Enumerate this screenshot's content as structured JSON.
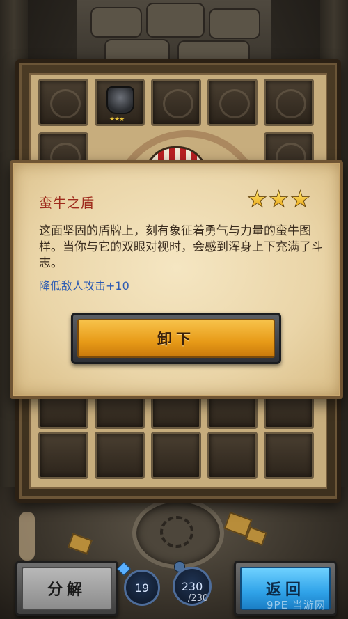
{
  "item": {
    "name": "蛮牛之盾",
    "star_count": 3,
    "description": "这面坚固的盾牌上，刻有象征着勇气与力量的蛮牛图样。当你与它的双眼对视时，会感到浑身上下充满了斗志。",
    "effect": "降低敌人攻击+10"
  },
  "buttons": {
    "unequip_label": "卸下",
    "decompose_label": "分解",
    "back_label": "返回"
  },
  "counters": {
    "gem_value": "19",
    "inventory_count": "230",
    "inventory_max": "/230"
  },
  "watermark": "9PE 当游网",
  "colors": {
    "item_name": "#9e2b1c",
    "effect_text": "#2c5bb3",
    "unequip_button": "#e79a17",
    "back_button": "#2fa2e8",
    "decompose_button": "#8c8c8c"
  },
  "inventory": {
    "equipped_slot_icon": "armor-icon",
    "equipped_slot_stars": "★★★"
  }
}
